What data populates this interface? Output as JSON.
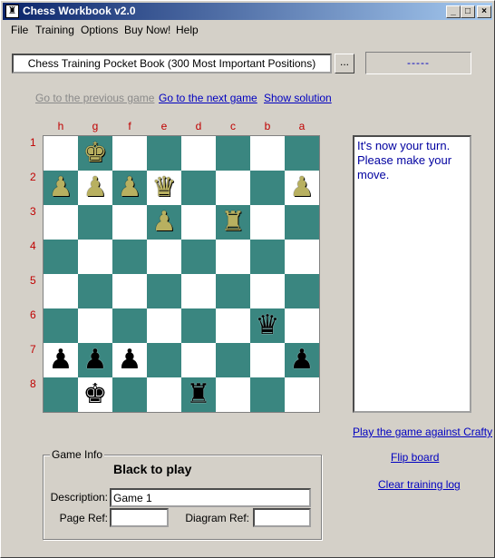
{
  "window": {
    "title": "Chess Workbook v2.0",
    "icon": "chess-board-icon",
    "min_symbol": "_",
    "max_symbol": "□",
    "close_symbol": "×"
  },
  "menu": [
    {
      "label": "File"
    },
    {
      "label": "Training"
    },
    {
      "label": "Options"
    },
    {
      "label": "Buy Now!"
    },
    {
      "label": "Help"
    }
  ],
  "book": {
    "name": "Chess Training Pocket Book (300 Most Important Positions)",
    "browse_label": "...",
    "status": "-----"
  },
  "nav": {
    "prev": "Go to the previous game",
    "next": "Go to the next game",
    "solution": "Show solution"
  },
  "board": {
    "files": [
      "h",
      "g",
      "f",
      "e",
      "d",
      "c",
      "b",
      "a"
    ],
    "ranks": [
      "1",
      "2",
      "3",
      "4",
      "5",
      "6",
      "7",
      "8"
    ],
    "light_color": "#ffffff",
    "dark_color": "#3a8680",
    "rows": [
      [
        "",
        "wK",
        "",
        "",
        "",
        "",
        "",
        ""
      ],
      [
        "wP",
        "wP",
        "wP",
        "wQ",
        "",
        "",
        "",
        "wP"
      ],
      [
        "",
        "",
        "",
        "wP",
        "",
        "wR",
        "",
        ""
      ],
      [
        "",
        "",
        "",
        "",
        "",
        "",
        "",
        ""
      ],
      [
        "",
        "",
        "",
        "",
        "",
        "",
        "",
        ""
      ],
      [
        "",
        "",
        "",
        "",
        "",
        "",
        "bQ",
        ""
      ],
      [
        "bP",
        "bP",
        "bP",
        "",
        "",
        "",
        "",
        "bP"
      ],
      [
        "",
        "bK",
        "",
        "",
        "bR",
        "",
        "",
        ""
      ]
    ]
  },
  "message": "It's now your turn. Please make your move.",
  "links": {
    "crafty": "Play the game against Crafty",
    "flip": "Flip board",
    "clear": "Clear training log"
  },
  "game_info": {
    "legend": "Game Info",
    "to_play": "Black to play",
    "description_label": "Description:",
    "description_value": "Game 1",
    "page_ref_label": "Page Ref:",
    "page_ref_value": "",
    "diagram_ref_label": "Diagram Ref:",
    "diagram_ref_value": ""
  }
}
